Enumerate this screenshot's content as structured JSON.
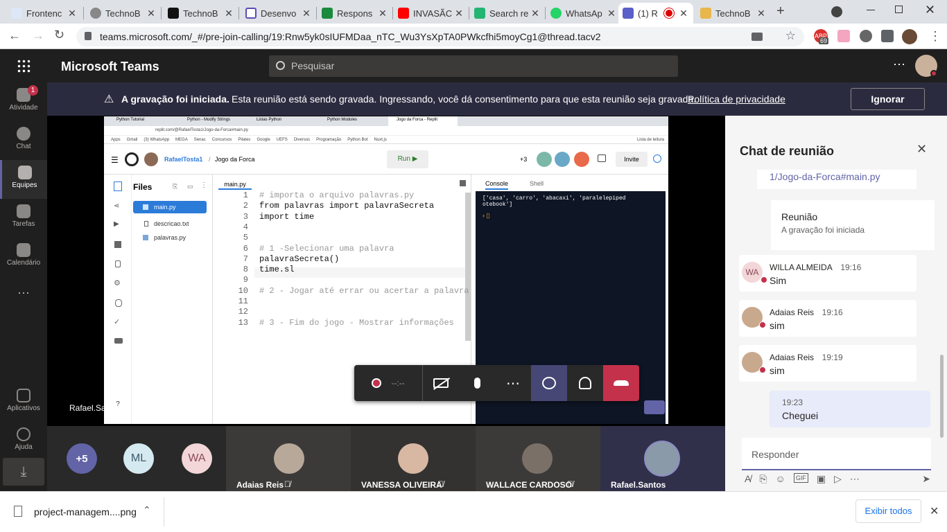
{
  "browser": {
    "tabs": [
      {
        "label": "Frontenc",
        "color": "#dde7f7"
      },
      {
        "label": "TechnoB",
        "color": "#888888"
      },
      {
        "label": "TechnoB",
        "color": "#111111"
      },
      {
        "label": "Desenvo",
        "color": "#5b4bb5"
      },
      {
        "label": "Respons",
        "color": "#1a8a3c"
      },
      {
        "label": "INVASÃC",
        "color": "#ff0000"
      },
      {
        "label": "Search re",
        "color": "#22b573"
      },
      {
        "label": "WhatsAp",
        "color": "#25d366"
      },
      {
        "label": "(1) R",
        "color": "#5b5fc7"
      },
      {
        "label": "TechnoB",
        "color": "#e8b64a"
      }
    ],
    "url": "teams.microsoft.com/_#/pre-join-calling/19:Rnw5yk0sIUFMDaa_nTC_Wu3YsXpTA0PWkcfhi5moyCg1@thread.tacv2",
    "ext_badge": "69"
  },
  "teams": {
    "app_title": "Microsoft Teams",
    "search_placeholder": "Pesquisar",
    "rail": [
      {
        "label": "Atividade",
        "badge": "1"
      },
      {
        "label": "Chat"
      },
      {
        "label": "Equipes"
      },
      {
        "label": "Tarefas"
      },
      {
        "label": "Calendário"
      },
      {
        "label": "Aplicativos"
      },
      {
        "label": "Ajuda"
      }
    ],
    "banner": {
      "bold": "A gravação foi iniciada.",
      "text": "Esta reunião está sendo gravada. Ingressando, você dá consentimento para que esta reunião seja gravada.",
      "link": "Política de privacidade",
      "button": "Ignorar"
    },
    "presenter_name": "Rafael.Santos",
    "call_timer": "--:--"
  },
  "shared_screen": {
    "tabs": [
      "Python Tutorial",
      "Python - Modify Strings",
      "Listas Python",
      "Python Modules",
      "Jogo da Forca - Replit"
    ],
    "url": "replit.com/@RafaelTosta1/Jogo-da-Forca#main.py",
    "bookmarks": [
      "Apps",
      "Gmail",
      "(3) WhatsApp",
      "MEGA",
      "Senac",
      "Concursos",
      "Pilates",
      "Google",
      "UEFS",
      "Diversos",
      "Programação",
      "Python Bot",
      "Nuxt.js",
      "Lista de leitura"
    ],
    "user": "RafaelTosta1",
    "repl": "Jogo da Forca",
    "run": "Run",
    "plus_count": "+3",
    "invite": "Invite",
    "files_title": "Files",
    "files": [
      "main.py",
      "descricao.txt",
      "palavras.py"
    ],
    "editor_tab": "main.py",
    "console_tab": "Console",
    "shell_tab": "Shell",
    "console_output": "['casa', 'carro', 'abacaxi', 'paralelepiped\notebook']",
    "code_lines": [
      {
        "n": "1",
        "text": "# importa o arquivo palavras.py",
        "cls": "cm"
      },
      {
        "n": "2",
        "text": "from palavras import palavraSecreta",
        "cls": ""
      },
      {
        "n": "3",
        "text": "import time",
        "cls": ""
      },
      {
        "n": "4",
        "text": "",
        "cls": ""
      },
      {
        "n": "5",
        "text": "",
        "cls": ""
      },
      {
        "n": "6",
        "text": "# 1 -Selecionar uma palavra",
        "cls": "cm"
      },
      {
        "n": "7",
        "text": "palavraSecreta()",
        "cls": ""
      },
      {
        "n": "8",
        "text": "time.sl",
        "cls": ""
      },
      {
        "n": "9",
        "text": "",
        "cls": ""
      },
      {
        "n": "10",
        "text": "# 2 - Jogar até errar ou acertar a palavra",
        "cls": "cm"
      },
      {
        "n": "11",
        "text": "",
        "cls": ""
      },
      {
        "n": "12",
        "text": "",
        "cls": ""
      },
      {
        "n": "13",
        "text": "# 3 - Fim do jogo - Mostrar informações",
        "cls": "cm"
      }
    ]
  },
  "participants": [
    {
      "initials": "+5",
      "color": "#6264a7"
    },
    {
      "initials": "ML",
      "color": "#d5eaf0"
    },
    {
      "initials": "WA",
      "color": "#f2d6d8"
    },
    {
      "name": "Adaias Reis"
    },
    {
      "name": "VANESSA OLIVEIRA"
    },
    {
      "name": "WALLACE CARDOSO"
    },
    {
      "name": "Rafael.Santos"
    }
  ],
  "chat": {
    "title": "Chat de reunião",
    "link_text": "1/Jogo-da-Forca#main.py",
    "event_title": "Reunião",
    "event_text": "A gravação foi iniciada",
    "messages": [
      {
        "author": "WILLA ALMEIDA",
        "time": "19:16",
        "text": "Sim",
        "initials": "WA"
      },
      {
        "author": "Adaias Reis",
        "time": "19:16",
        "text": "sim"
      },
      {
        "author": "Adaias Reis",
        "time": "19:19",
        "text": "sim"
      }
    ],
    "own": {
      "time": "19:23",
      "text": "Cheguei"
    },
    "reply_placeholder": "Responder"
  },
  "download": {
    "file": "project-managem....png",
    "show_all": "Exibir todos"
  }
}
